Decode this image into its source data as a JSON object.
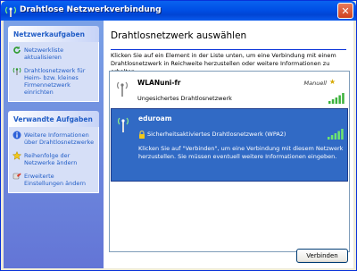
{
  "window": {
    "title": "Drahtlose Netzwerkverbindung",
    "close_symbol": "✕"
  },
  "sidebar": {
    "panels": [
      {
        "title": "Netzwerkaufgaben",
        "tasks": [
          {
            "label": "Netzwerkliste aktualisieren",
            "icon": "refresh-icon"
          },
          {
            "label": "Drahtlosnetzwerk für Heim- bzw. kleines Firmennetzwerk einrichten",
            "icon": "wireless-setup-icon"
          }
        ]
      },
      {
        "title": "Verwandte Aufgaben",
        "tasks": [
          {
            "label": "Weitere Informationen über Drahtlosnetzwerke",
            "icon": "info-icon"
          },
          {
            "label": "Reihenfolge der Netzwerke ändern",
            "icon": "star-icon"
          },
          {
            "label": "Erweiterte Einstellungen ändern",
            "icon": "settings-icon"
          }
        ]
      }
    ]
  },
  "main": {
    "title": "Drahtlosnetzwerk auswählen",
    "instructions": "Klicken Sie auf ein Element in der Liste unten, um eine Verbindung mit einem Drahtlosnetzwerk in Reichweite herzustellen oder weitere Informationen zu erhalten.",
    "networks": [
      {
        "name": "WLANuni-fr",
        "mode": "Manuell",
        "status": "Ungesichertes Drahtlosnetzwerk",
        "selected": false
      },
      {
        "name": "eduroam",
        "status": "Sicherheitsaktiviertes Drahtlosnetzwerk (WPA2)",
        "description": "Klicken Sie auf \"Verbinden\", um eine Verbindung mit diesem Netzwerk herzustellen. Sie müssen eventuell weitere Informationen eingeben.",
        "selected": true
      }
    ],
    "connect_label": "Verbinden"
  },
  "colors": {
    "titlebar": "#0050e6",
    "sidebar": "#6375d6",
    "selection": "#316ac5",
    "signal": "#3cb23c"
  }
}
